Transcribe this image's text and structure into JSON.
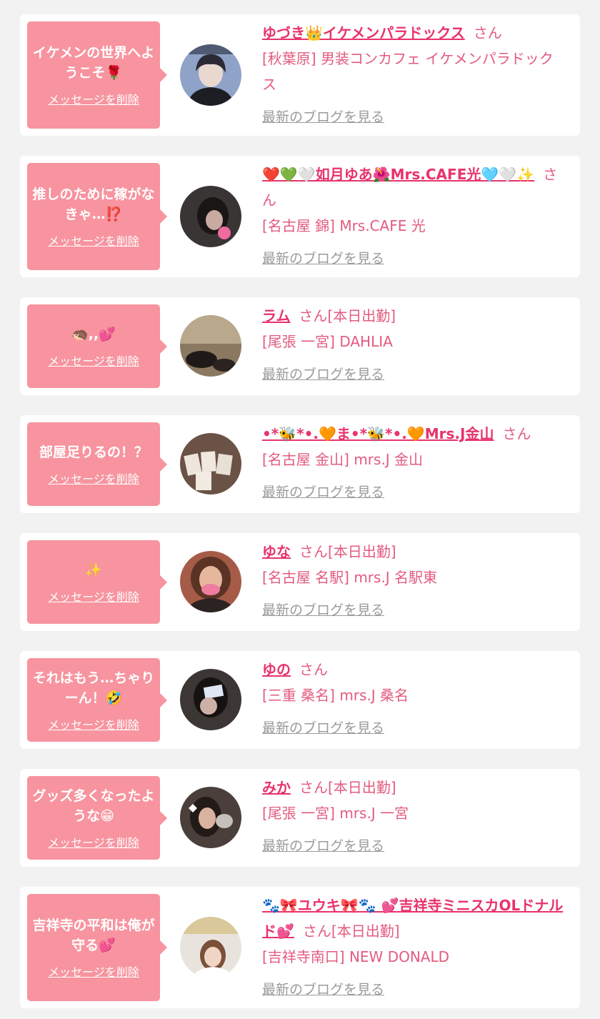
{
  "cards": [
    {
      "bubble_message": "イケメンの世界へようこそ🌹",
      "delete_label": "メッセージを削除",
      "name": "ゆづき👑イケメンパラドックス",
      "suffix": "さん",
      "shop": "[秋葉原] 男装コンカフェ イケメンパラドックス",
      "blog_link": "最新のブログを見る",
      "avatar_color": "#8fa2c8"
    },
    {
      "bubble_message": "推しのために稼がなきゃ…⁉️",
      "delete_label": "メッセージを削除",
      "name": "❤️💚🤍如月ゆあ🌺Mrs.CAFE光🩵🤍✨",
      "suffix": "さん",
      "shop": "[名古屋 錦] Mrs.CAFE 光",
      "blog_link": "最新のブログを見る",
      "avatar_color": "#3a3535"
    },
    {
      "bubble_message": "🦔,,💕",
      "delete_label": "メッセージを削除",
      "name": "ラム",
      "suffix": "さん[本日出勤]",
      "shop": "[尾張 一宮] DAHLIA",
      "blog_link": "最新のブログを見る",
      "avatar_color": "#8a7860"
    },
    {
      "bubble_message": "部屋足りるの！？",
      "delete_label": "メッセージを削除",
      "name": "•*🐝*•.🧡ま•*🐝*•.🧡Mrs.J金山",
      "suffix": "さん",
      "shop": "[名古屋 金山] mrs.J 金山",
      "blog_link": "最新のブログを見る",
      "avatar_color": "#6b5246"
    },
    {
      "bubble_message": "✨",
      "delete_label": "メッセージを削除",
      "name": "ゆな",
      "suffix": "さん[本日出勤]",
      "shop": "[名古屋 名駅] mrs.J 名駅東",
      "blog_link": "最新のブログを見る",
      "avatar_color": "#a55b47"
    },
    {
      "bubble_message": "それはもう…ちゃりーん！🤣",
      "delete_label": "メッセージを削除",
      "name": "ゆの",
      "suffix": "さん",
      "shop": "[三重 桑名] mrs.J 桑名",
      "blog_link": "最新のブログを見る",
      "avatar_color": "#3c3634"
    },
    {
      "bubble_message": "グッズ多くなったような😁",
      "delete_label": "メッセージを削除",
      "name": "みか",
      "suffix": "さん[本日出勤]",
      "shop": "[尾張 一宮] mrs.J 一宮",
      "blog_link": "最新のブログを見る",
      "avatar_color": "#4a3f3a"
    },
    {
      "bubble_message": "吉祥寺の平和は俺が守る💕",
      "delete_label": "メッセージを削除",
      "name": "🐾🎀ユウキ🎀🐾 💕吉祥寺ミニスカOLドナルド💕",
      "suffix": "さん[本日出勤]",
      "shop": "[吉祥寺南口] NEW DONALD",
      "blog_link": "最新のブログを見る",
      "avatar_color": "#e8e4dd"
    }
  ]
}
